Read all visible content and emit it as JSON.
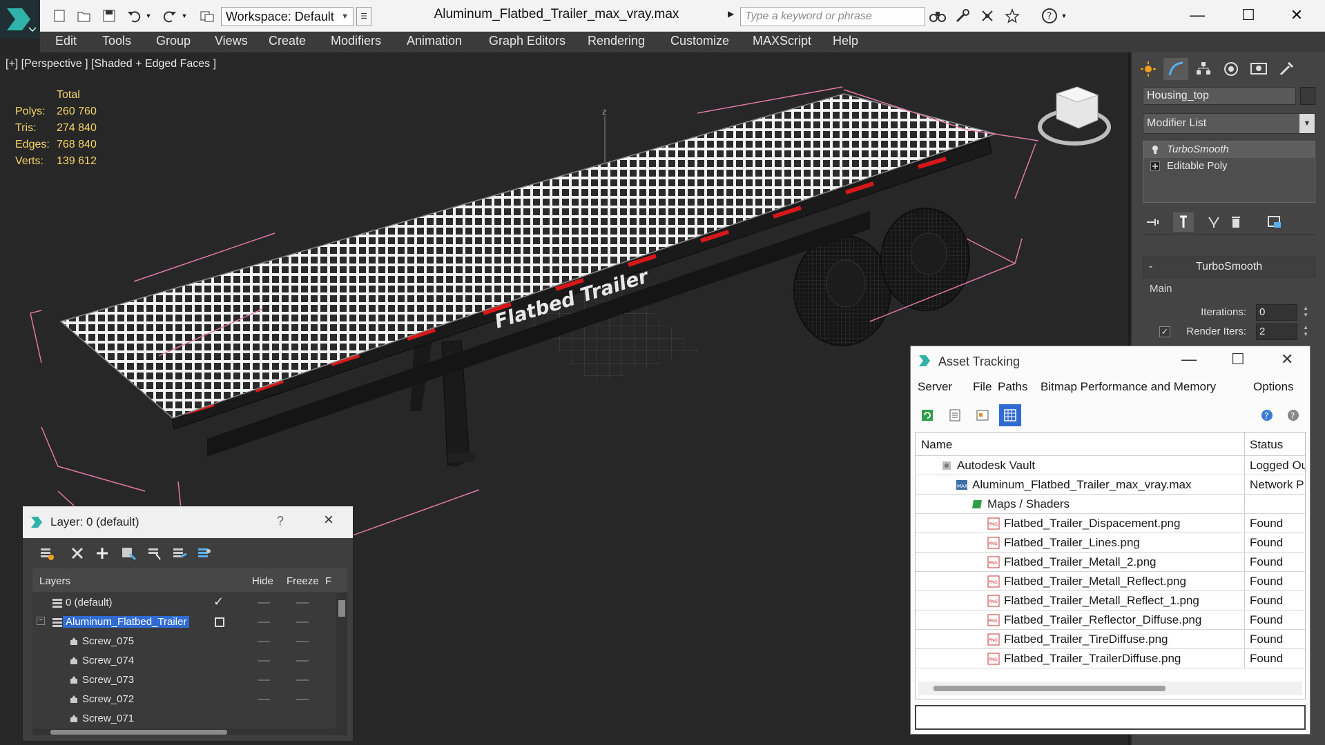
{
  "titlebar": {
    "title": "Aluminum_Flatbed_Trailer_max_vray.max",
    "workspace": "Workspace: Default",
    "search_placeholder": "Type a keyword or phrase"
  },
  "menu": [
    "Edit",
    "Tools",
    "Group",
    "Views",
    "Create",
    "Modifiers",
    "Animation",
    "Graph Editors",
    "Rendering",
    "Customize",
    "MAXScript",
    "Help"
  ],
  "viewport": {
    "label": "[+] [Perspective ] [Shaded + Edged Faces ]",
    "stats_header": "Total",
    "stats": [
      {
        "label": "Polys:",
        "value": "260 760"
      },
      {
        "label": "Tris:",
        "value": "274 840"
      },
      {
        "label": "Edges:",
        "value": "768 840"
      },
      {
        "label": "Verts:",
        "value": "139 612"
      }
    ],
    "trailer_text": "Flatbed Trailer",
    "axis_label": "z"
  },
  "command_panel": {
    "object_name": "Housing_top",
    "modifier_list": "Modifier List",
    "stack": [
      "TurboSmooth",
      "Editable Poly"
    ],
    "rollout_title": "TurboSmooth",
    "group_main": "Main",
    "iterations_label": "Iterations:",
    "iterations_value": "0",
    "render_iters_label": "Render Iters:",
    "render_iters_value": "2"
  },
  "layer_panel": {
    "title": "Layer: 0 (default)",
    "help": "?",
    "columns": [
      "Layers",
      "Hide",
      "Freeze",
      "F"
    ],
    "rows": [
      {
        "name": "0 (default)",
        "level": 0
      },
      {
        "name": "Aluminum_Flatbed_Trailer",
        "level": 0
      },
      {
        "name": "Screw_075",
        "level": 1
      },
      {
        "name": "Screw_074",
        "level": 1
      },
      {
        "name": "Screw_073",
        "level": 1
      },
      {
        "name": "Screw_072",
        "level": 1
      },
      {
        "name": "Screw_071",
        "level": 1
      }
    ]
  },
  "asset_panel": {
    "title": "Asset Tracking",
    "menu": [
      "Server",
      "File",
      "Paths",
      "Bitmap Performance and Memory",
      "Options"
    ],
    "columns": [
      "Name",
      "Status"
    ],
    "rows": [
      {
        "name": "Autodesk Vault",
        "status": "Logged Ou"
      },
      {
        "name": "Aluminum_Flatbed_Trailer_max_vray.max",
        "status": "Network P"
      },
      {
        "name": "Maps / Shaders",
        "status": ""
      },
      {
        "name": "Flatbed_Trailer_Dispacement.png",
        "status": "Found"
      },
      {
        "name": "Flatbed_Trailer_Lines.png",
        "status": "Found"
      },
      {
        "name": "Flatbed_Trailer_Metall_2.png",
        "status": "Found"
      },
      {
        "name": "Flatbed_Trailer_Metall_Reflect.png",
        "status": "Found"
      },
      {
        "name": "Flatbed_Trailer_Metall_Reflect_1.png",
        "status": "Found"
      },
      {
        "name": "Flatbed_Trailer_Reflector_Diffuse.png",
        "status": "Found"
      },
      {
        "name": "Flatbed_Trailer_TireDiffuse.png",
        "status": "Found"
      },
      {
        "name": "Flatbed_Trailer_TrailerDiffuse.png",
        "status": "Found"
      }
    ]
  }
}
